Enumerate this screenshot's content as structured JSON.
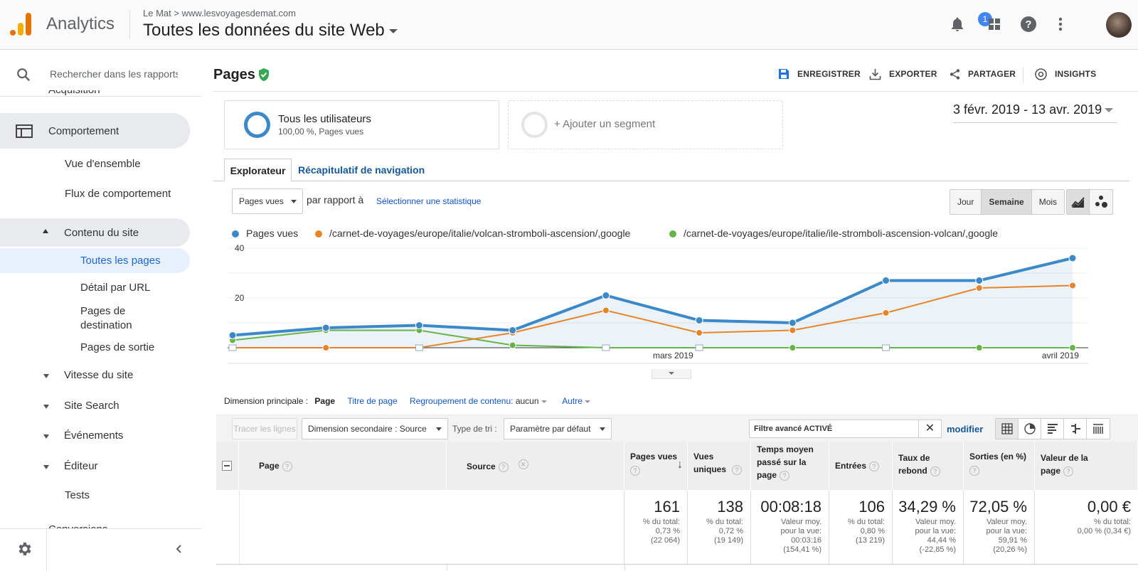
{
  "header": {
    "app_name": "Analytics",
    "account": "Le Mat",
    "property": "www.lesvoyagesdemat.com",
    "view": "Toutes les données du site Web",
    "notif_count": "1"
  },
  "sidebar": {
    "search_placeholder": "Rechercher dans les rapports",
    "partial_top": "Acquisition",
    "section": "Comportement",
    "items": [
      "Vue d'ensemble",
      "Flux de comportement",
      "Contenu du site",
      "Toutes les pages",
      "Détail par URL",
      "Pages de destination",
      "Pages de sortie",
      "Vitesse du site",
      "Site Search",
      "Événements",
      "Éditeur",
      "Tests"
    ],
    "partial_bottom": "Conversions"
  },
  "page": {
    "title": "Pages",
    "actions": [
      "ENREGISTRER",
      "EXPORTER",
      "PARTAGER",
      "INSIGHTS"
    ],
    "date_range": "3 févr. 2019 - 13 avr. 2019"
  },
  "segments": {
    "active_name": "Tous les utilisateurs",
    "active_sub": "100,00 %, Pages vues",
    "add": "+ Ajouter un segment"
  },
  "tabs": [
    "Explorateur",
    "Récapitulatif de navigation"
  ],
  "chart_controls": {
    "metric": "Pages vues",
    "compare": "par rapport à",
    "select_metric": "Sélectionner une statistique",
    "periods": [
      "Jour",
      "Semaine",
      "Mois"
    ],
    "active_period": "Semaine"
  },
  "chart_data": {
    "type": "line",
    "x": [
      "2019-02-03",
      "2019-02-10",
      "2019-02-17",
      "2019-02-24",
      "2019-03-03",
      "2019-03-10",
      "2019-03-17",
      "2019-03-24",
      "2019-03-31",
      "2019-04-07"
    ],
    "xticks": [
      "mars 2019",
      "avril 2019"
    ],
    "yticks": [
      "40",
      "20"
    ],
    "ylim": [
      0,
      40
    ],
    "series": [
      {
        "name": "Pages vues",
        "color": "#3b89c9",
        "values": [
          5,
          8,
          9,
          7,
          21,
          11,
          10,
          27,
          27,
          36
        ]
      },
      {
        "name": "/carnet-de-voyages/europe/italie/volcan-stromboli-ascension/,google",
        "color": "#e8832a",
        "values": [
          0,
          0,
          0,
          6,
          15,
          6,
          7,
          14,
          24,
          25
        ]
      },
      {
        "name": "/carnet-de-voyages/europe/italie/ile-stromboli-ascension-volcan/,google",
        "color": "#67b347",
        "values": [
          3,
          7,
          7,
          1,
          0,
          0,
          0,
          0,
          0,
          0
        ]
      }
    ]
  },
  "dimension": {
    "label": "Dimension principale :",
    "active": "Page",
    "options": [
      "Titre de page"
    ],
    "grouping_label": "Regroupement de contenu:",
    "grouping_value": "aucun",
    "other": "Autre"
  },
  "toolbar": {
    "plot_rows": "Tracer les lignes",
    "secondary": "Dimension secondaire : Source",
    "sort_label": "Type de tri :",
    "sort_value": "Paramètre par défaut",
    "filter_value": "Filtre avancé ACTIVÉ",
    "modify": "modifier"
  },
  "table": {
    "headers": [
      "Page",
      "Source",
      "Pages vues",
      "Vues uniques",
      "Temps moyen passé sur la page",
      "Entrées",
      "Taux de rebond",
      "Sorties (en %)",
      "Valeur de la page"
    ],
    "totals": [
      {
        "value": "161",
        "lines": [
          "% du total:",
          "0,73 %",
          "(22 064)"
        ]
      },
      {
        "value": "138",
        "lines": [
          "% du total:",
          "0,72 %",
          "(19 149)"
        ]
      },
      {
        "value": "00:08:18",
        "lines": [
          "Valeur moy.",
          "pour la vue:",
          "00:03:16",
          "(154,41 %)"
        ]
      },
      {
        "value": "106",
        "lines": [
          "% du total:",
          "0,80 %",
          "(13 219)"
        ]
      },
      {
        "value": "34,29 %",
        "lines": [
          "Valeur moy.",
          "pour la vue:",
          "44,44 %",
          "(-22,85 %)"
        ]
      },
      {
        "value": "72,05 %",
        "lines": [
          "Valeur moy.",
          "pour la vue:",
          "59,91 %",
          "(20,26 %)"
        ]
      },
      {
        "value": "0,00 €",
        "lines": [
          "% du total:",
          "0,00 % (0,34 €)"
        ]
      }
    ]
  }
}
